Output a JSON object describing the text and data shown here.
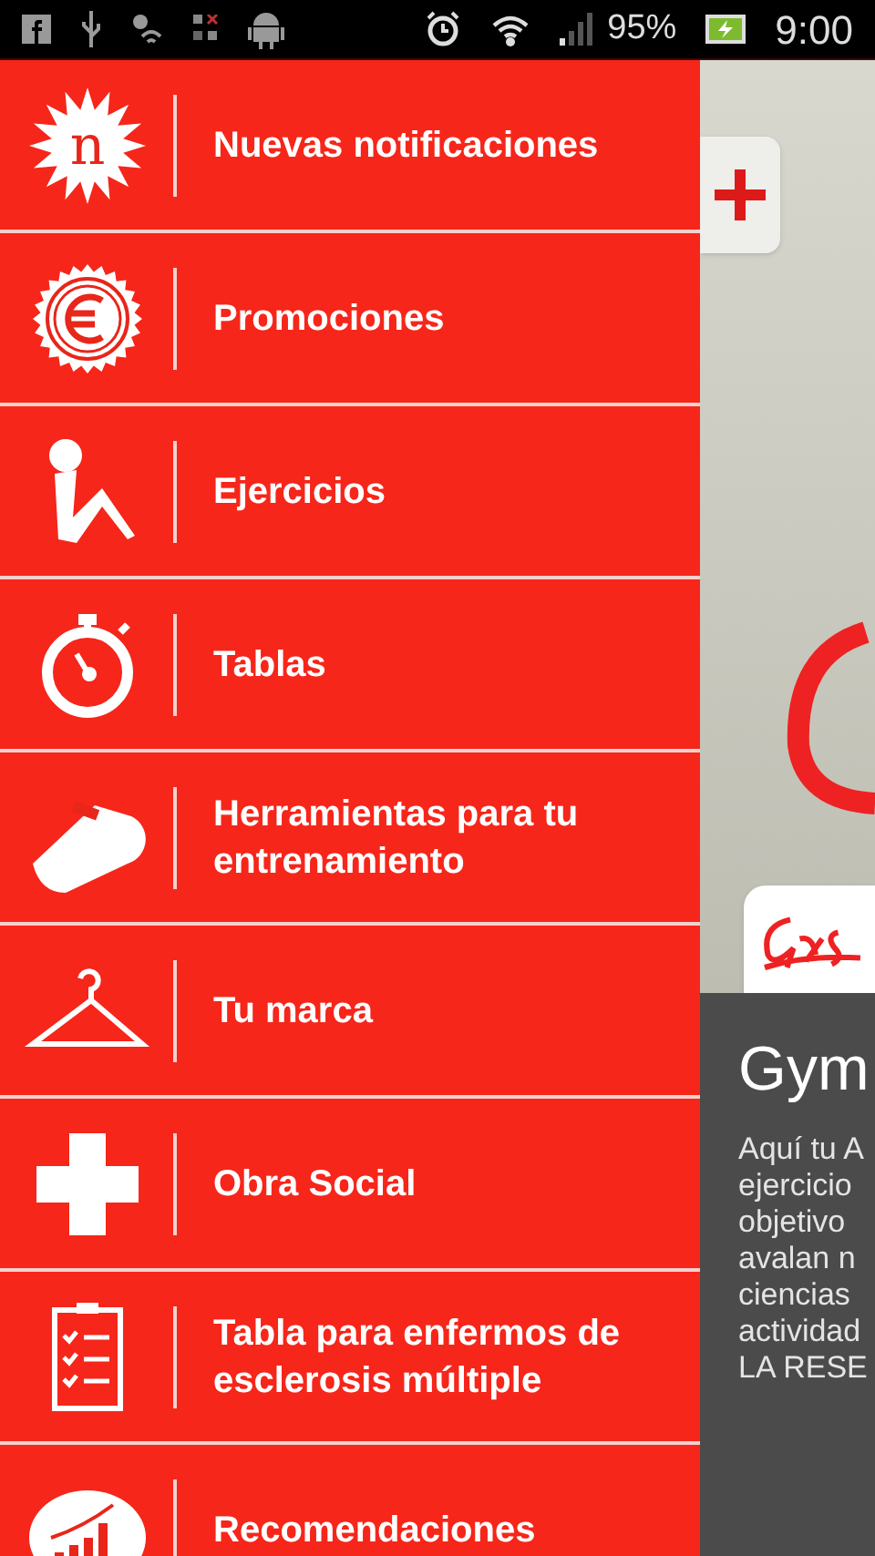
{
  "status_bar": {
    "battery": "95%",
    "time": "9:00"
  },
  "menu": [
    {
      "kind": "notification",
      "icon_letter": "n",
      "label": "Nuevas notificaciones"
    },
    {
      "kind": "promo",
      "label": "Promociones"
    },
    {
      "kind": "exercise",
      "label": "Ejercicios"
    },
    {
      "kind": "timer",
      "label": "Tablas"
    },
    {
      "kind": "whistle",
      "label": "Herramientas para tu entrenamiento"
    },
    {
      "kind": "hanger",
      "label": "Tu marca"
    },
    {
      "kind": "cross",
      "label": "Obra Social"
    },
    {
      "kind": "checklist",
      "label": "Tabla para enfermos de esclerosis múltiple"
    },
    {
      "kind": "chart",
      "label": "Recomendaciones"
    }
  ],
  "content": {
    "title": "Gym",
    "text_lines": [
      "Aquí tu A",
      "ejercicio",
      "objetivo",
      "avalan n",
      "ciencias",
      "actividad",
      "LA RESE"
    ]
  }
}
